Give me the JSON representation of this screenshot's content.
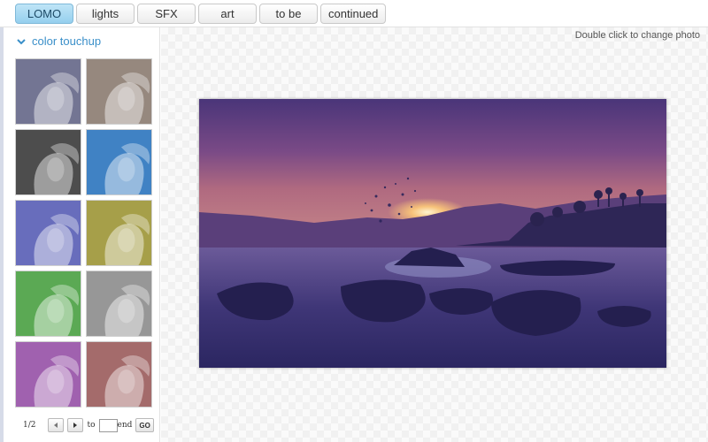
{
  "tabs": [
    {
      "label": "LOMO",
      "active": true
    },
    {
      "label": "lights",
      "active": false
    },
    {
      "label": "SFX",
      "active": false
    },
    {
      "label": "art",
      "active": false
    },
    {
      "label": "to be",
      "active": false
    },
    {
      "label": "continued",
      "active": false
    }
  ],
  "sidebar": {
    "section_title": "color touchup",
    "thumbnails": [
      {
        "tint": "#8d8fb4"
      },
      {
        "tint": "#b8a79a"
      },
      {
        "tint": "#5e5e5e"
      },
      {
        "tint": "#4f9ff0"
      },
      {
        "tint": "#7f86e6"
      },
      {
        "tint": "#cbc25a"
      },
      {
        "tint": "#6fcf67"
      },
      {
        "tint": "#b9b9b9"
      },
      {
        "tint": "#c477d6"
      },
      {
        "tint": "#c98383"
      }
    ],
    "pager": {
      "page_indicator": "1/2",
      "to_label": "to",
      "end_label": "end",
      "go_label": "GO",
      "page_input_value": ""
    }
  },
  "main": {
    "hint": "Double click to change photo"
  },
  "colors": {
    "accent": "#3a8fc9",
    "active_tab": "#a9dbf2"
  }
}
